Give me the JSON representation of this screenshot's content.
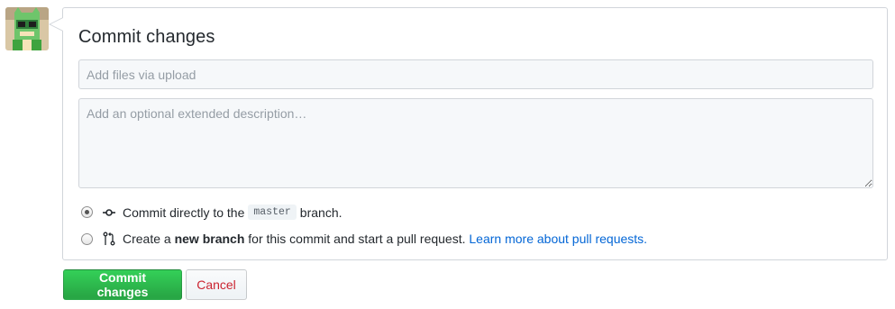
{
  "avatar": {
    "icon": "user-avatar-icon"
  },
  "form": {
    "title": "Commit changes",
    "summary_placeholder": "Add files via upload",
    "summary_value": "",
    "description_placeholder": "Add an optional extended description…",
    "description_value": ""
  },
  "options": {
    "direct": {
      "selected": true,
      "icon": "git-commit-icon",
      "text_before": "Commit directly to the",
      "branch": "master",
      "text_after": "branch."
    },
    "new_branch": {
      "selected": false,
      "icon": "git-pull-request-icon",
      "text_before": "Create a",
      "bold": "new branch",
      "text_after": "for this commit and start a pull request.",
      "link": "Learn more about pull requests."
    }
  },
  "buttons": {
    "commit_label": "Commit changes",
    "cancel_label": "Cancel"
  },
  "colors": {
    "primary": "#28a745",
    "cancel_text": "#cb2431",
    "link": "#0366d6"
  }
}
